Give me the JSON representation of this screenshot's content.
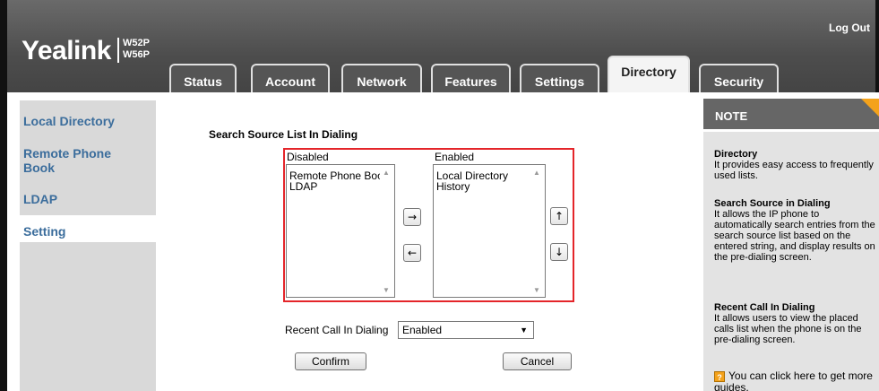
{
  "header": {
    "logo": "Yealink",
    "model_line1": "W52P",
    "model_line2": "W56P",
    "logout_label": "Log Out"
  },
  "tabs": [
    {
      "label": "Status"
    },
    {
      "label": "Account"
    },
    {
      "label": "Network"
    },
    {
      "label": "Features"
    },
    {
      "label": "Settings"
    },
    {
      "label": "Directory",
      "active": true
    },
    {
      "label": "Security"
    }
  ],
  "sidebar": {
    "items": [
      {
        "label": "Local Directory"
      },
      {
        "label": "Remote Phone Book"
      },
      {
        "label": "LDAP"
      },
      {
        "label": "Setting",
        "active": true
      }
    ]
  },
  "main": {
    "section_title": "Search Source List In Dialing",
    "disabled_label": "Disabled",
    "enabled_label": "Enabled",
    "disabled_items": [
      "Remote Phone Boo",
      "LDAP"
    ],
    "enabled_items": [
      "Local Directory",
      "History"
    ],
    "move_right_symbol": "→",
    "move_left_symbol": "←",
    "move_up_symbol": "↑",
    "move_down_symbol": "↓",
    "recent_call_label": "Recent Call In Dialing",
    "recent_call_value": "Enabled",
    "confirm_label": "Confirm",
    "cancel_label": "Cancel"
  },
  "note": {
    "title": "NOTE",
    "directory_heading": "Directory",
    "directory_text": "It provides easy access to frequently used lists.",
    "search_heading": "Search Source in Dialing",
    "search_text": "It allows the IP phone to automatically search entries from the search source list based on the entered string, and display results on the pre-dialing screen.",
    "recent_heading": "Recent Call In Dialing",
    "recent_text": "It allows users to view the placed calls list when the phone is on the pre-dialing screen.",
    "tip_text": "You can click here to get more guides."
  },
  "colors": {
    "header_bg": "#555555",
    "link_blue": "#3b6d9c",
    "highlight_red": "#e4252a",
    "accent_orange": "#f4a21b"
  }
}
